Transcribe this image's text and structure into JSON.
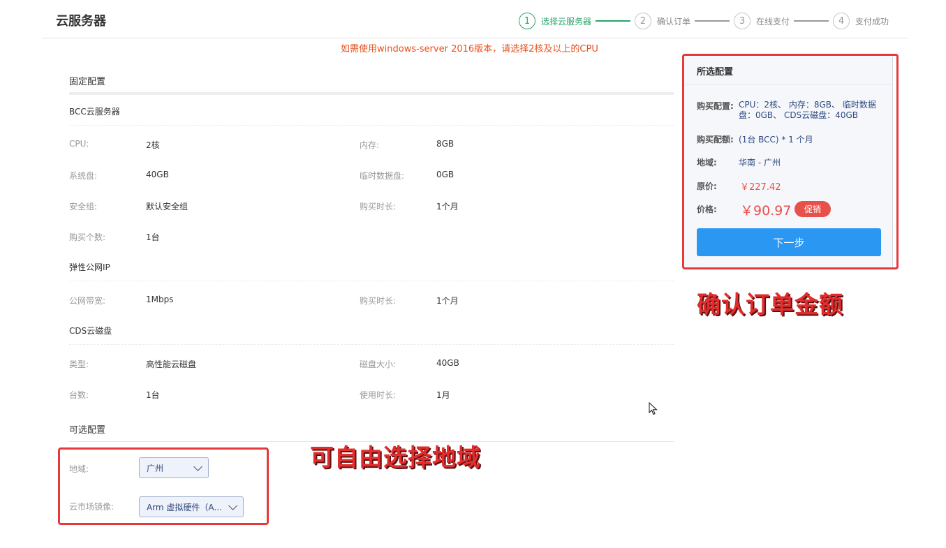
{
  "page": {
    "title": "云服务器"
  },
  "steps": [
    {
      "num": "1",
      "label": "选择云服务器"
    },
    {
      "num": "2",
      "label": "确认订单"
    },
    {
      "num": "3",
      "label": "在线支付"
    },
    {
      "num": "4",
      "label": "支付成功"
    }
  ],
  "notice": "如需使用windows-server 2016版本，请选择2核及以上的CPU",
  "fixed": {
    "title": "固定配置",
    "bcc": {
      "title": "BCC云服务器",
      "cpu_label": "CPU:",
      "cpu_value": "2核",
      "mem_label": "内存:",
      "mem_value": "8GB",
      "sysdisk_label": "系统盘:",
      "sysdisk_value": "40GB",
      "tempdisk_label": "临时数据盘:",
      "tempdisk_value": "0GB",
      "secgroup_label": "安全组:",
      "secgroup_value": "默认安全组",
      "duration_label": "购买时长:",
      "duration_value": "1个月",
      "count_label": "购买个数:",
      "count_value": "1台"
    },
    "eip": {
      "title": "弹性公网IP",
      "bandwidth_label": "公网带宽:",
      "bandwidth_value": "1Mbps",
      "duration_label": "购买时长:",
      "duration_value": "1个月"
    },
    "cds": {
      "title": "CDS云磁盘",
      "type_label": "类型:",
      "type_value": "高性能云磁盘",
      "size_label": "磁盘大小:",
      "size_value": "40GB",
      "count_label": "台数:",
      "count_value": "1台",
      "usage_label": "使用时长:",
      "usage_value": "1月"
    }
  },
  "optional": {
    "title": "可选配置",
    "region_label": "地域:",
    "region_value": "广州",
    "image_label": "云市场镜像:",
    "image_value": "Arm 虚拟硬件（A..."
  },
  "annotations": {
    "region": "可自由选择地域",
    "order": "确认订单金额"
  },
  "summary": {
    "title": "所选配置",
    "config_label": "购买配置:",
    "config_value": "CPU：2核、 内存：8GB、 临时数据盘：0GB、 CDS云磁盘：40GB",
    "amount_label": "购买配额:",
    "amount_value": "(1台 BCC) * 1 个月",
    "region_label": "地域:",
    "region_value": "华南 - 广州",
    "orig_label": "原价:",
    "orig_value": "￥227.42",
    "price_label": "价格:",
    "price_value": "￥90.97",
    "promo": "促销",
    "next_button": "下一步"
  },
  "colors": {
    "accent_green": "#26a66b",
    "notice_orange": "#e8501c",
    "price_red": "#e8504a",
    "button_blue": "#2a97f2",
    "highlight_red": "#e5393b"
  }
}
